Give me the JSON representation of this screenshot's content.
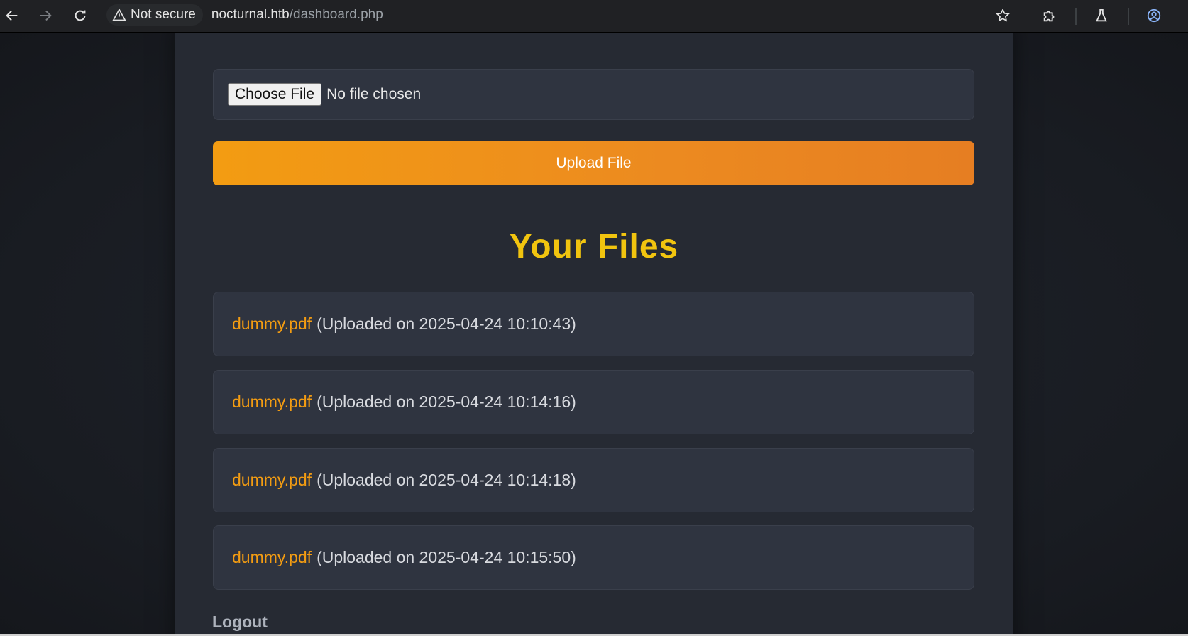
{
  "browser": {
    "security_label": "Not secure",
    "url_host": "nocturnal.htb",
    "url_path": "/dashboard.php"
  },
  "page": {
    "file_input": {
      "button_label": "Choose File",
      "status_text": "No file chosen"
    },
    "upload_button_label": "Upload File",
    "files_title": "Your Files",
    "files": [
      {
        "name": "dummy.pdf",
        "meta": "(Uploaded on 2025-04-24 10:10:43)"
      },
      {
        "name": "dummy.pdf",
        "meta": "(Uploaded on 2025-04-24 10:14:16)"
      },
      {
        "name": "dummy.pdf",
        "meta": "(Uploaded on 2025-04-24 10:14:18)"
      },
      {
        "name": "dummy.pdf",
        "meta": "(Uploaded on 2025-04-24 10:15:50)"
      }
    ],
    "logout_label": "Logout"
  },
  "colors": {
    "accent_yellow": "#f1c40f",
    "accent_orange": "#f39c12",
    "card_bg": "#2f3440",
    "container_bg": "#262a33"
  }
}
